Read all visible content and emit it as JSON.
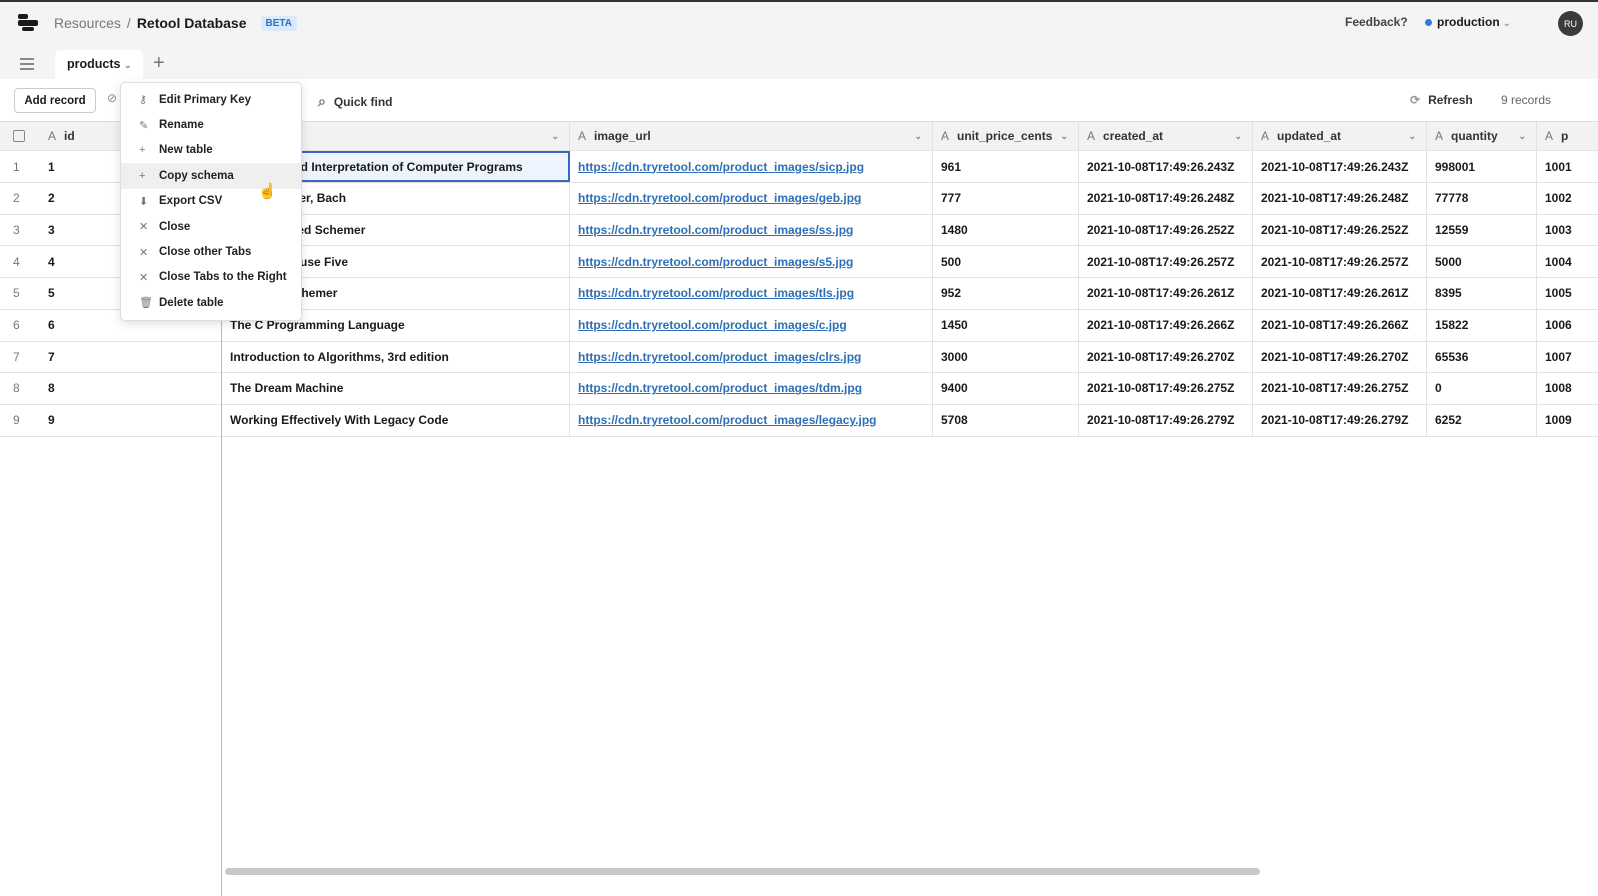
{
  "header": {
    "breadcrumb_parent": "Resources",
    "separator": "/",
    "title": "Retool Database",
    "badge": "BETA",
    "feedback": "Feedback?",
    "environment": "production",
    "env_color": "#2f7fd4",
    "avatar_initials": "RU"
  },
  "tabs": {
    "active": "products"
  },
  "toolbar": {
    "add_record": "Add record",
    "quick_find": "Quick find",
    "refresh": "Refresh",
    "record_count": "9 records"
  },
  "menu": {
    "items": [
      {
        "label": "Edit Primary Key",
        "icon": "key-icon",
        "glyph": "⚷"
      },
      {
        "label": "Rename",
        "icon": "pencil-icon",
        "glyph": "✎"
      },
      {
        "label": "New table",
        "icon": "plus-icon",
        "glyph": "+"
      },
      {
        "label": "Copy schema",
        "icon": "plus-icon",
        "glyph": "+"
      },
      {
        "label": "Export CSV",
        "icon": "download-icon",
        "glyph": "⬇"
      },
      {
        "label": "Close",
        "icon": "close-icon",
        "glyph": "✕"
      },
      {
        "label": "Close other Tabs",
        "icon": "close-icon",
        "glyph": "✕"
      },
      {
        "label": "Close Tabs to the Right",
        "icon": "close-icon",
        "glyph": "✕"
      },
      {
        "label": "Delete table",
        "icon": "trash-icon",
        "glyph": "🗑"
      }
    ],
    "hovered": 3
  },
  "table": {
    "columns": [
      "id",
      "",
      "image_url",
      "unit_price_cents",
      "created_at",
      "updated_at",
      "quantity",
      "p"
    ],
    "rows": [
      [
        "1",
        "1",
        "Structure and Interpretation of Computer Programs",
        "https://cdn.tryretool.com/product_images/sicp.jpg",
        "961",
        "2021-10-08T17:49:26.243Z",
        "2021-10-08T17:49:26.243Z",
        "998001",
        "1001"
      ],
      [
        "2",
        "2",
        "Gödel, Escher, Bach",
        "https://cdn.tryretool.com/product_images/geb.jpg",
        "777",
        "2021-10-08T17:49:26.248Z",
        "2021-10-08T17:49:26.248Z",
        "77778",
        "1002"
      ],
      [
        "3",
        "3",
        "The Seasoned Schemer",
        "https://cdn.tryretool.com/product_images/ss.jpg",
        "1480",
        "2021-10-08T17:49:26.252Z",
        "2021-10-08T17:49:26.252Z",
        "12559",
        "1003"
      ],
      [
        "4",
        "4",
        "Slaughterhouse Five",
        "https://cdn.tryretool.com/product_images/s5.jpg",
        "500",
        "2021-10-08T17:49:26.257Z",
        "2021-10-08T17:49:26.257Z",
        "5000",
        "1004"
      ],
      [
        "5",
        "5",
        "The Little Schemer",
        "https://cdn.tryretool.com/product_images/tls.jpg",
        "952",
        "2021-10-08T17:49:26.261Z",
        "2021-10-08T17:49:26.261Z",
        "8395",
        "1005"
      ],
      [
        "6",
        "6",
        "The C Programming Language",
        "https://cdn.tryretool.com/product_images/c.jpg",
        "1450",
        "2021-10-08T17:49:26.266Z",
        "2021-10-08T17:49:26.266Z",
        "15822",
        "1006"
      ],
      [
        "7",
        "7",
        "Introduction to Algorithms, 3rd edition",
        "https://cdn.tryretool.com/product_images/clrs.jpg",
        "3000",
        "2021-10-08T17:49:26.270Z",
        "2021-10-08T17:49:26.270Z",
        "65536",
        "1007"
      ],
      [
        "8",
        "8",
        "The Dream Machine",
        "https://cdn.tryretool.com/product_images/tdm.jpg",
        "9400",
        "2021-10-08T17:49:26.275Z",
        "2021-10-08T17:49:26.275Z",
        "0",
        "1008"
      ],
      [
        "9",
        "9",
        "Working Effectively With Legacy Code",
        "https://cdn.tryretool.com/product_images/legacy.jpg",
        "5708",
        "2021-10-08T17:49:26.279Z",
        "2021-10-08T17:49:26.279Z",
        "6252",
        "1009"
      ]
    ]
  }
}
